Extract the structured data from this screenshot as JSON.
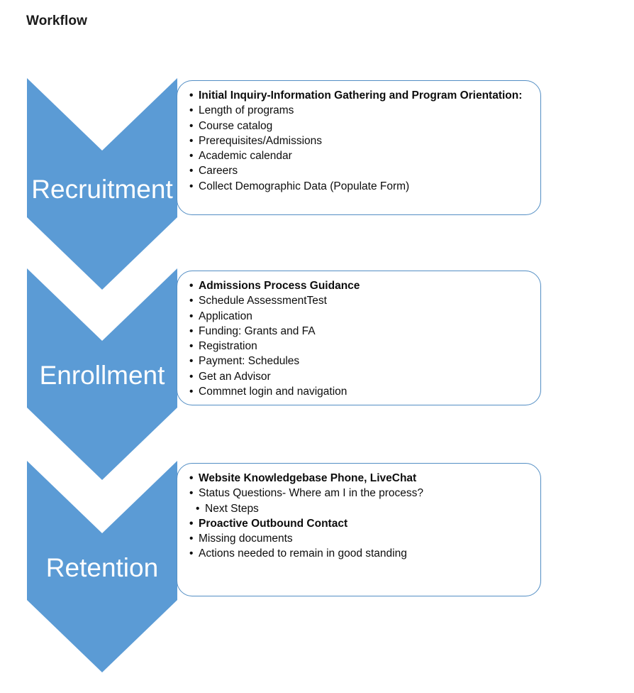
{
  "page": {
    "title": "Workflow",
    "accent_color": "#5B9BD5",
    "border_color": "#538EC4",
    "label_color": "#FFFFFF",
    "text_color": "#0D0D0D",
    "background": "#FFFFFF"
  },
  "stages": [
    {
      "label": "Recruitment",
      "items": [
        {
          "text": "Initial Inquiry-Information Gathering and Program Orientation:",
          "bold": true,
          "indent": false
        },
        {
          "text": "Length of programs",
          "bold": false,
          "indent": false
        },
        {
          "text": "Course catalog",
          "bold": false,
          "indent": false
        },
        {
          "text": "Prerequisites/Admissions",
          "bold": false,
          "indent": false
        },
        {
          "text": "Academic calendar",
          "bold": false,
          "indent": false
        },
        {
          "text": "Careers",
          "bold": false,
          "indent": false
        },
        {
          "text": "Collect Demographic Data (Populate Form)",
          "bold": false,
          "indent": false
        }
      ]
    },
    {
      "label": "Enrollment",
      "items": [
        {
          "text": "Admissions Process Guidance",
          "bold": true,
          "indent": false
        },
        {
          "text": "Schedule AssessmentTest",
          "bold": false,
          "indent": false
        },
        {
          "text": "Application",
          "bold": false,
          "indent": false
        },
        {
          "text": "Funding: Grants and FA",
          "bold": false,
          "indent": false
        },
        {
          "text": "Registration",
          "bold": false,
          "indent": false
        },
        {
          "text": "Payment: Schedules",
          "bold": false,
          "indent": false
        },
        {
          "text": "Get an Advisor",
          "bold": false,
          "indent": false
        },
        {
          "text": "Commnet login and navigation",
          "bold": false,
          "indent": false
        }
      ]
    },
    {
      "label": "Retention",
      "items": [
        {
          "text": "Website Knowledgebase Phone, LiveChat",
          "bold": true,
          "indent": false
        },
        {
          "text": "Status Questions- Where am I in the process?",
          "bold": false,
          "indent": false
        },
        {
          "text": "Next Steps",
          "bold": false,
          "indent": true
        },
        {
          "text": "Proactive Outbound Contact",
          "bold": true,
          "indent": false
        },
        {
          "text": "Missing documents",
          "bold": false,
          "indent": false
        },
        {
          "text": "Actions needed to remain in good standing",
          "bold": false,
          "indent": false
        }
      ]
    }
  ]
}
